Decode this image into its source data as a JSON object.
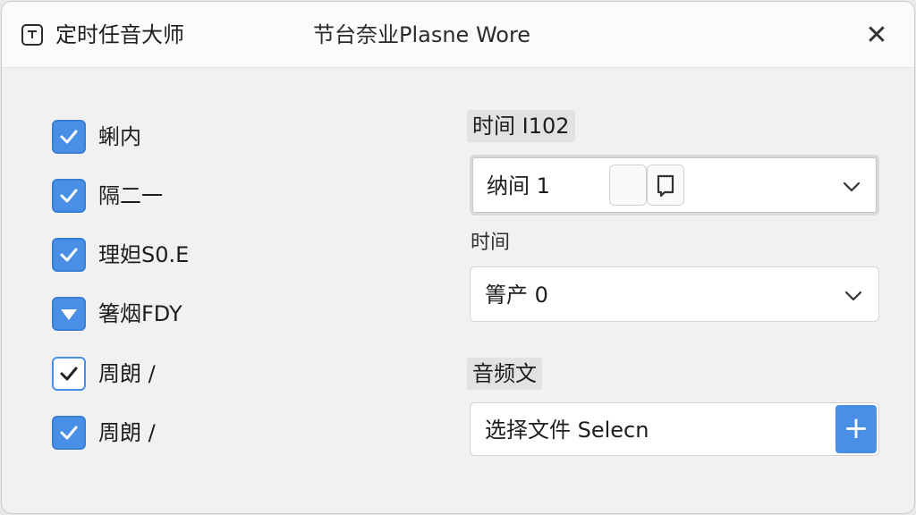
{
  "window": {
    "title": "定时任音大师",
    "center_title": "节台奈业Plasne Wore",
    "close_glyph": "✕"
  },
  "checklist": [
    {
      "label": "蜊内",
      "checked": true,
      "style": "filled"
    },
    {
      "label": "隔二一",
      "checked": true,
      "style": "filled"
    },
    {
      "label": "理妲S0.E",
      "checked": true,
      "style": "filled"
    },
    {
      "label": "箸烟FDY",
      "checked": true,
      "style": "filled"
    },
    {
      "label": "周朗 /",
      "checked": true,
      "style": "outline"
    },
    {
      "label": "周朗 /",
      "checked": true,
      "style": "filled"
    }
  ],
  "schedule": {
    "section_label": "时间 I102",
    "dropdown_value": "纳间 1"
  },
  "time": {
    "label": "时间",
    "dropdown_value": "箐产 0"
  },
  "audio": {
    "section_label": "音频文",
    "file_value": "选择文件 Selecn",
    "add_glyph": "+"
  },
  "colors": {
    "accent": "#4a8fe6",
    "window_bg": "#f1f1f1",
    "titlebar_bg": "#fbfbfb"
  },
  "icons": {
    "app": "app-icon",
    "close": "close-icon",
    "check": "checkmark-icon",
    "chevron": "chevron-down-icon",
    "comment": "comment-icon",
    "add": "plus-icon"
  }
}
